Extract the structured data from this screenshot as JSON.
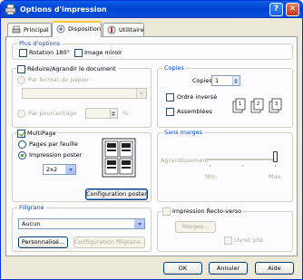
{
  "window": {
    "title": "Options d'impression"
  },
  "tabs": [
    {
      "label": "Principal",
      "active": false
    },
    {
      "label": "Disposition",
      "active": true
    },
    {
      "label": "Utilitaire",
      "active": false
    }
  ],
  "plus_options": {
    "title": "Plus d'options",
    "rotation_label": "Rotation 180°",
    "rotation_checked": false,
    "mirror_label": "Image miroir",
    "mirror_checked": false
  },
  "reduce": {
    "label": "Réduire/Agrandir le document",
    "checked": false,
    "by_paper_label": "Par format de papier",
    "paper_value": "",
    "by_percent_label": "Par pourcentage",
    "percent_value": "",
    "percent_unit": "%"
  },
  "copies": {
    "title": "Copies",
    "copies_label": "Copies",
    "copies_value": "1",
    "reverse_label": "Ordre inversé",
    "reverse_checked": false,
    "collate_label": "Assemblées",
    "collate_checked": false
  },
  "multipage": {
    "label": "MultiPage",
    "checked": true,
    "pages_per_sheet_label": "Pages par feuille",
    "poster_label": "Impression poster",
    "poster_value": "2x2",
    "config_poster_label": "Configuration poster"
  },
  "borderless": {
    "title": "Sans marges",
    "enlargement_label": "Agrandissement",
    "min_label": "Min.",
    "max_label": "Max.",
    "slider_level": 1.0
  },
  "watermark": {
    "title": "Filigrane",
    "value": "Aucun",
    "custom_label": "Personnalisé...",
    "config_label": "Configuration filigrane..."
  },
  "duplex": {
    "label": "Impression Recto-verso",
    "checked": false,
    "margins_label": "Marges...",
    "booklet_label": "Livret plié",
    "booklet_checked": false
  },
  "footer": {
    "ok": "OK",
    "cancel": "Annuler",
    "help": "Aide"
  },
  "colors": {
    "title_bar": "#0a4cda",
    "group_title": "#0046d5",
    "tab_highlight": "#ffc83c",
    "panel_bg": "#fcfcfe",
    "window_bg": "#ece9d8"
  }
}
